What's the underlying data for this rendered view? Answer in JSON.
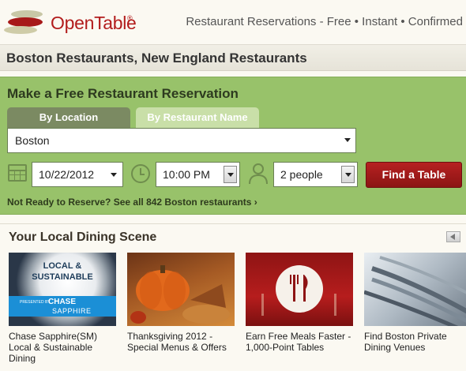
{
  "header": {
    "logo_text": "OpenTable",
    "logo_reg": "®",
    "tagline": "Restaurant Reservations - Free • Instant • Confirmed"
  },
  "page_title": "Boston Restaurants, New England Restaurants",
  "reservation": {
    "heading": "Make a Free Restaurant Reservation",
    "tabs": [
      {
        "label": "By Location",
        "active": true
      },
      {
        "label": "By Restaurant Name",
        "active": false
      }
    ],
    "location_value": "Boston",
    "date_value": "10/22/2012",
    "time_value": "10:00 PM",
    "party_value": "2 people",
    "find_button": "Find a Table",
    "not_ready_text": "Not Ready to Reserve? See all 842 Boston restaurants ›"
  },
  "dining_scene": {
    "heading": "Your Local Dining Scene",
    "cards": [
      {
        "caption": "Chase Sapphire(SM) Local & Sustainable Dining",
        "img_line1": "LOCAL &",
        "img_line2": "SUSTAINABLE",
        "img_presented": "PRESENTED BY",
        "img_chase": "CHASE",
        "img_sapphire": "SAPPHIRE"
      },
      {
        "caption": "Thanksgiving 2012 - Special Menus & Offers"
      },
      {
        "caption": "Earn Free Meals Faster - 1,000-Point Tables"
      },
      {
        "caption": "Find Boston Private Dining Venues"
      }
    ]
  },
  "colors": {
    "brand_red": "#b21c1c",
    "panel_green": "#98c26a",
    "button_red": "#a01a1a"
  }
}
